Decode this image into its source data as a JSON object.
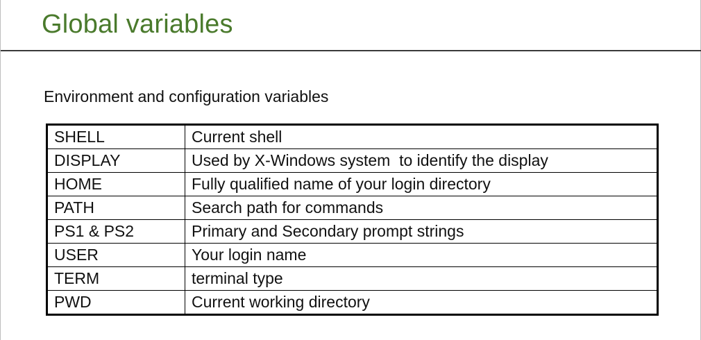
{
  "slide": {
    "title": "Global variables",
    "subtitle": "Environment and configuration variables",
    "title_color": "#4a7a2c"
  },
  "table": {
    "rows": [
      {
        "name": "SHELL",
        "description": "Current shell"
      },
      {
        "name": "DISPLAY",
        "description": "Used by X-Windows system  to identify the display"
      },
      {
        "name": "HOME",
        "description": "Fully qualified name of your login directory"
      },
      {
        "name": "PATH",
        "description": "Search path for commands"
      },
      {
        "name": "PS1 & PS2",
        "description": "Primary and Secondary prompt strings"
      },
      {
        "name": "USER",
        "description": "Your login name"
      },
      {
        "name": "TERM",
        "description": "terminal type"
      },
      {
        "name": "PWD",
        "description": "Current working directory"
      }
    ]
  }
}
